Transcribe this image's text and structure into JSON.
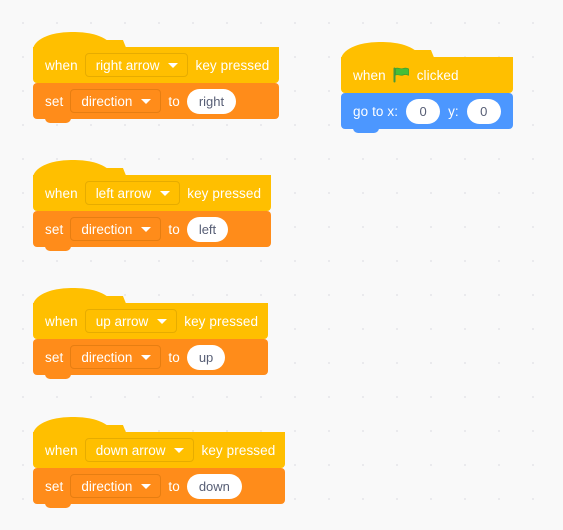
{
  "workspace": {
    "background_color": "#f9f9f9",
    "grid_dot_color": "#e9e9ec"
  },
  "palette": {
    "event_hat_color": "#ffbf00",
    "variable_block_color": "#ff8c1a",
    "motion_block_color": "#4c97ff",
    "field_text_color": "#575e75"
  },
  "scripts": [
    {
      "id": "script-right-arrow",
      "hat": {
        "prefix": "when",
        "dropdown_value": "right arrow",
        "suffix": "key pressed",
        "dropdown_icon": "chevron-down-icon"
      },
      "body": {
        "prefix": "set",
        "dropdown_value": "direction",
        "middle": "to",
        "value": "right",
        "dropdown_icon": "chevron-down-icon"
      }
    },
    {
      "id": "script-left-arrow",
      "hat": {
        "prefix": "when",
        "dropdown_value": "left arrow",
        "suffix": "key pressed",
        "dropdown_icon": "chevron-down-icon"
      },
      "body": {
        "prefix": "set",
        "dropdown_value": "direction",
        "middle": "to",
        "value": "left",
        "dropdown_icon": "chevron-down-icon"
      }
    },
    {
      "id": "script-up-arrow",
      "hat": {
        "prefix": "when",
        "dropdown_value": "up arrow",
        "suffix": "key pressed",
        "dropdown_icon": "chevron-down-icon"
      },
      "body": {
        "prefix": "set",
        "dropdown_value": "direction",
        "middle": "to",
        "value": "up",
        "dropdown_icon": "chevron-down-icon"
      }
    },
    {
      "id": "script-down-arrow",
      "hat": {
        "prefix": "when",
        "dropdown_value": "down arrow",
        "suffix": "key pressed",
        "dropdown_icon": "chevron-down-icon"
      },
      "body": {
        "prefix": "set",
        "dropdown_value": "direction",
        "middle": "to",
        "value": "down",
        "dropdown_icon": "chevron-down-icon"
      }
    }
  ],
  "flag_script": {
    "id": "script-green-flag",
    "hat": {
      "prefix": "when",
      "icon": "green-flag-icon",
      "suffix": "clicked"
    },
    "body": {
      "prefix": "go to x:",
      "x_value": "0",
      "y_label": "y:",
      "y_value": "0"
    }
  }
}
